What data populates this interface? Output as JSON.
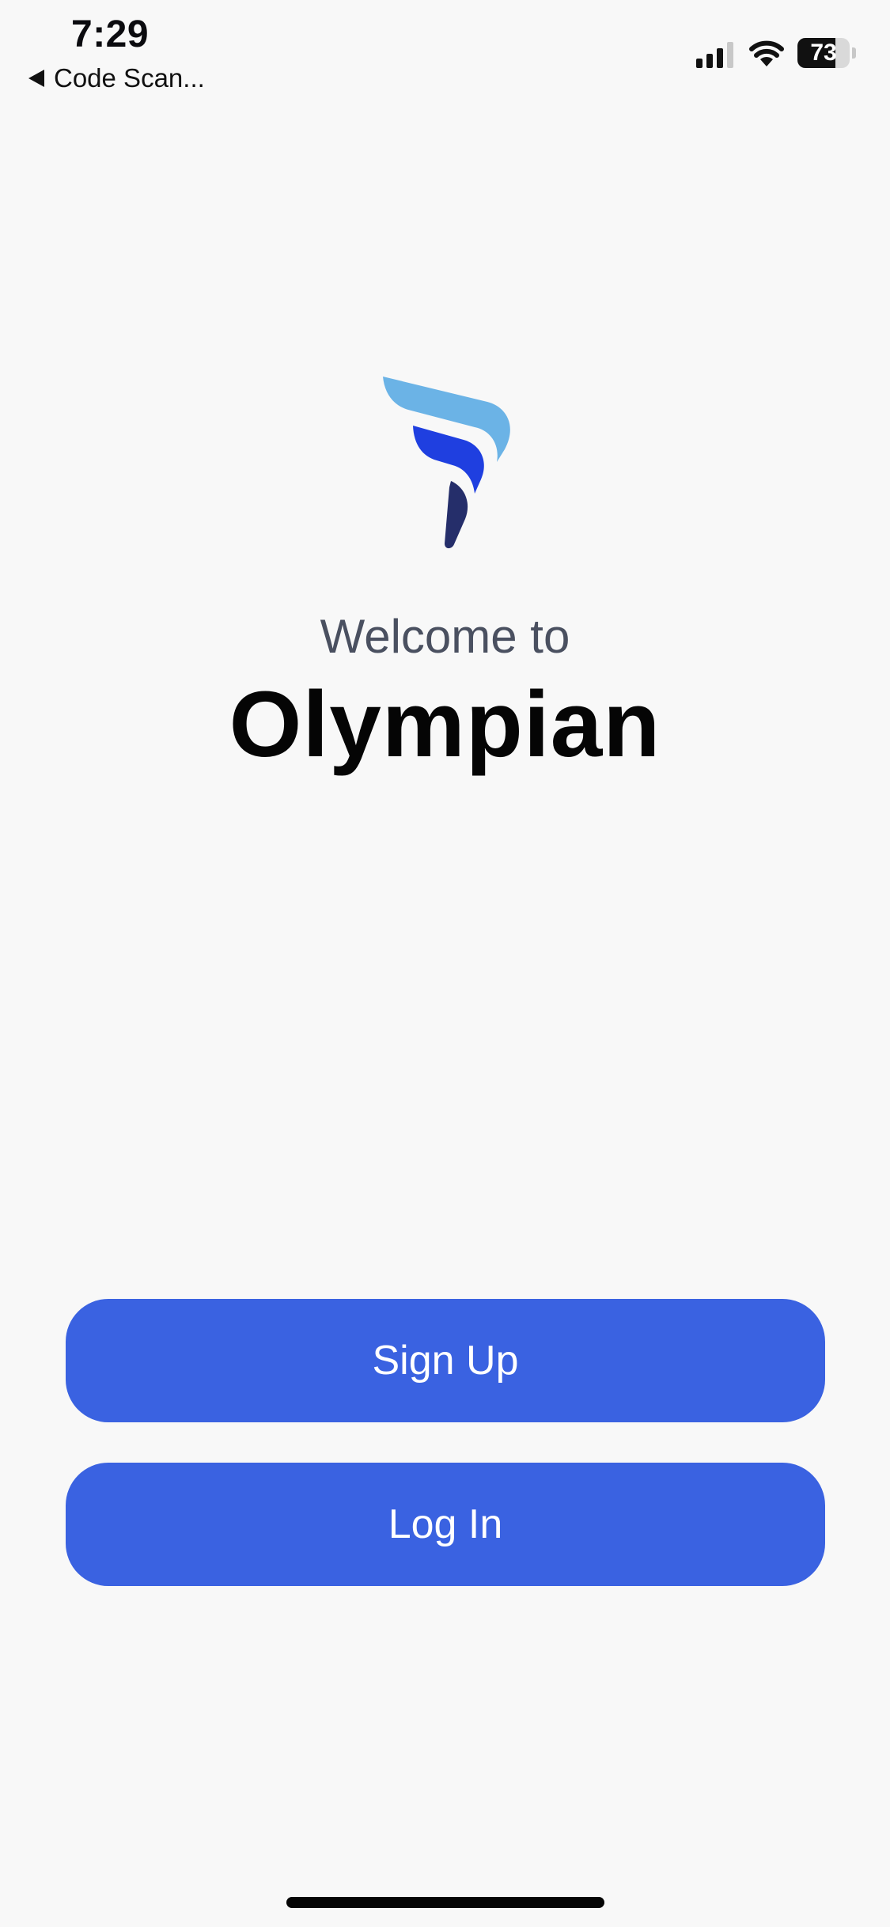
{
  "status_bar": {
    "time": "7:29",
    "back_label": "Code Scan...",
    "signal_bars_active": 3,
    "signal_bars_total": 4,
    "battery_level": "73",
    "battery_fraction": 0.73
  },
  "welcome": {
    "subtitle": "Welcome to",
    "app_name": "Olympian"
  },
  "logo": {
    "icon": "olympian-logo",
    "colors": [
      "#6bb3e6",
      "#1f3fe0",
      "#252e6a"
    ]
  },
  "actions": {
    "signup_label": "Sign Up",
    "login_label": "Log In"
  },
  "colors": {
    "background": "#f8f8f8",
    "button": "#3a62e1",
    "button_text": "#ffffff",
    "subtitle": "#4a5060",
    "title": "#050505"
  }
}
